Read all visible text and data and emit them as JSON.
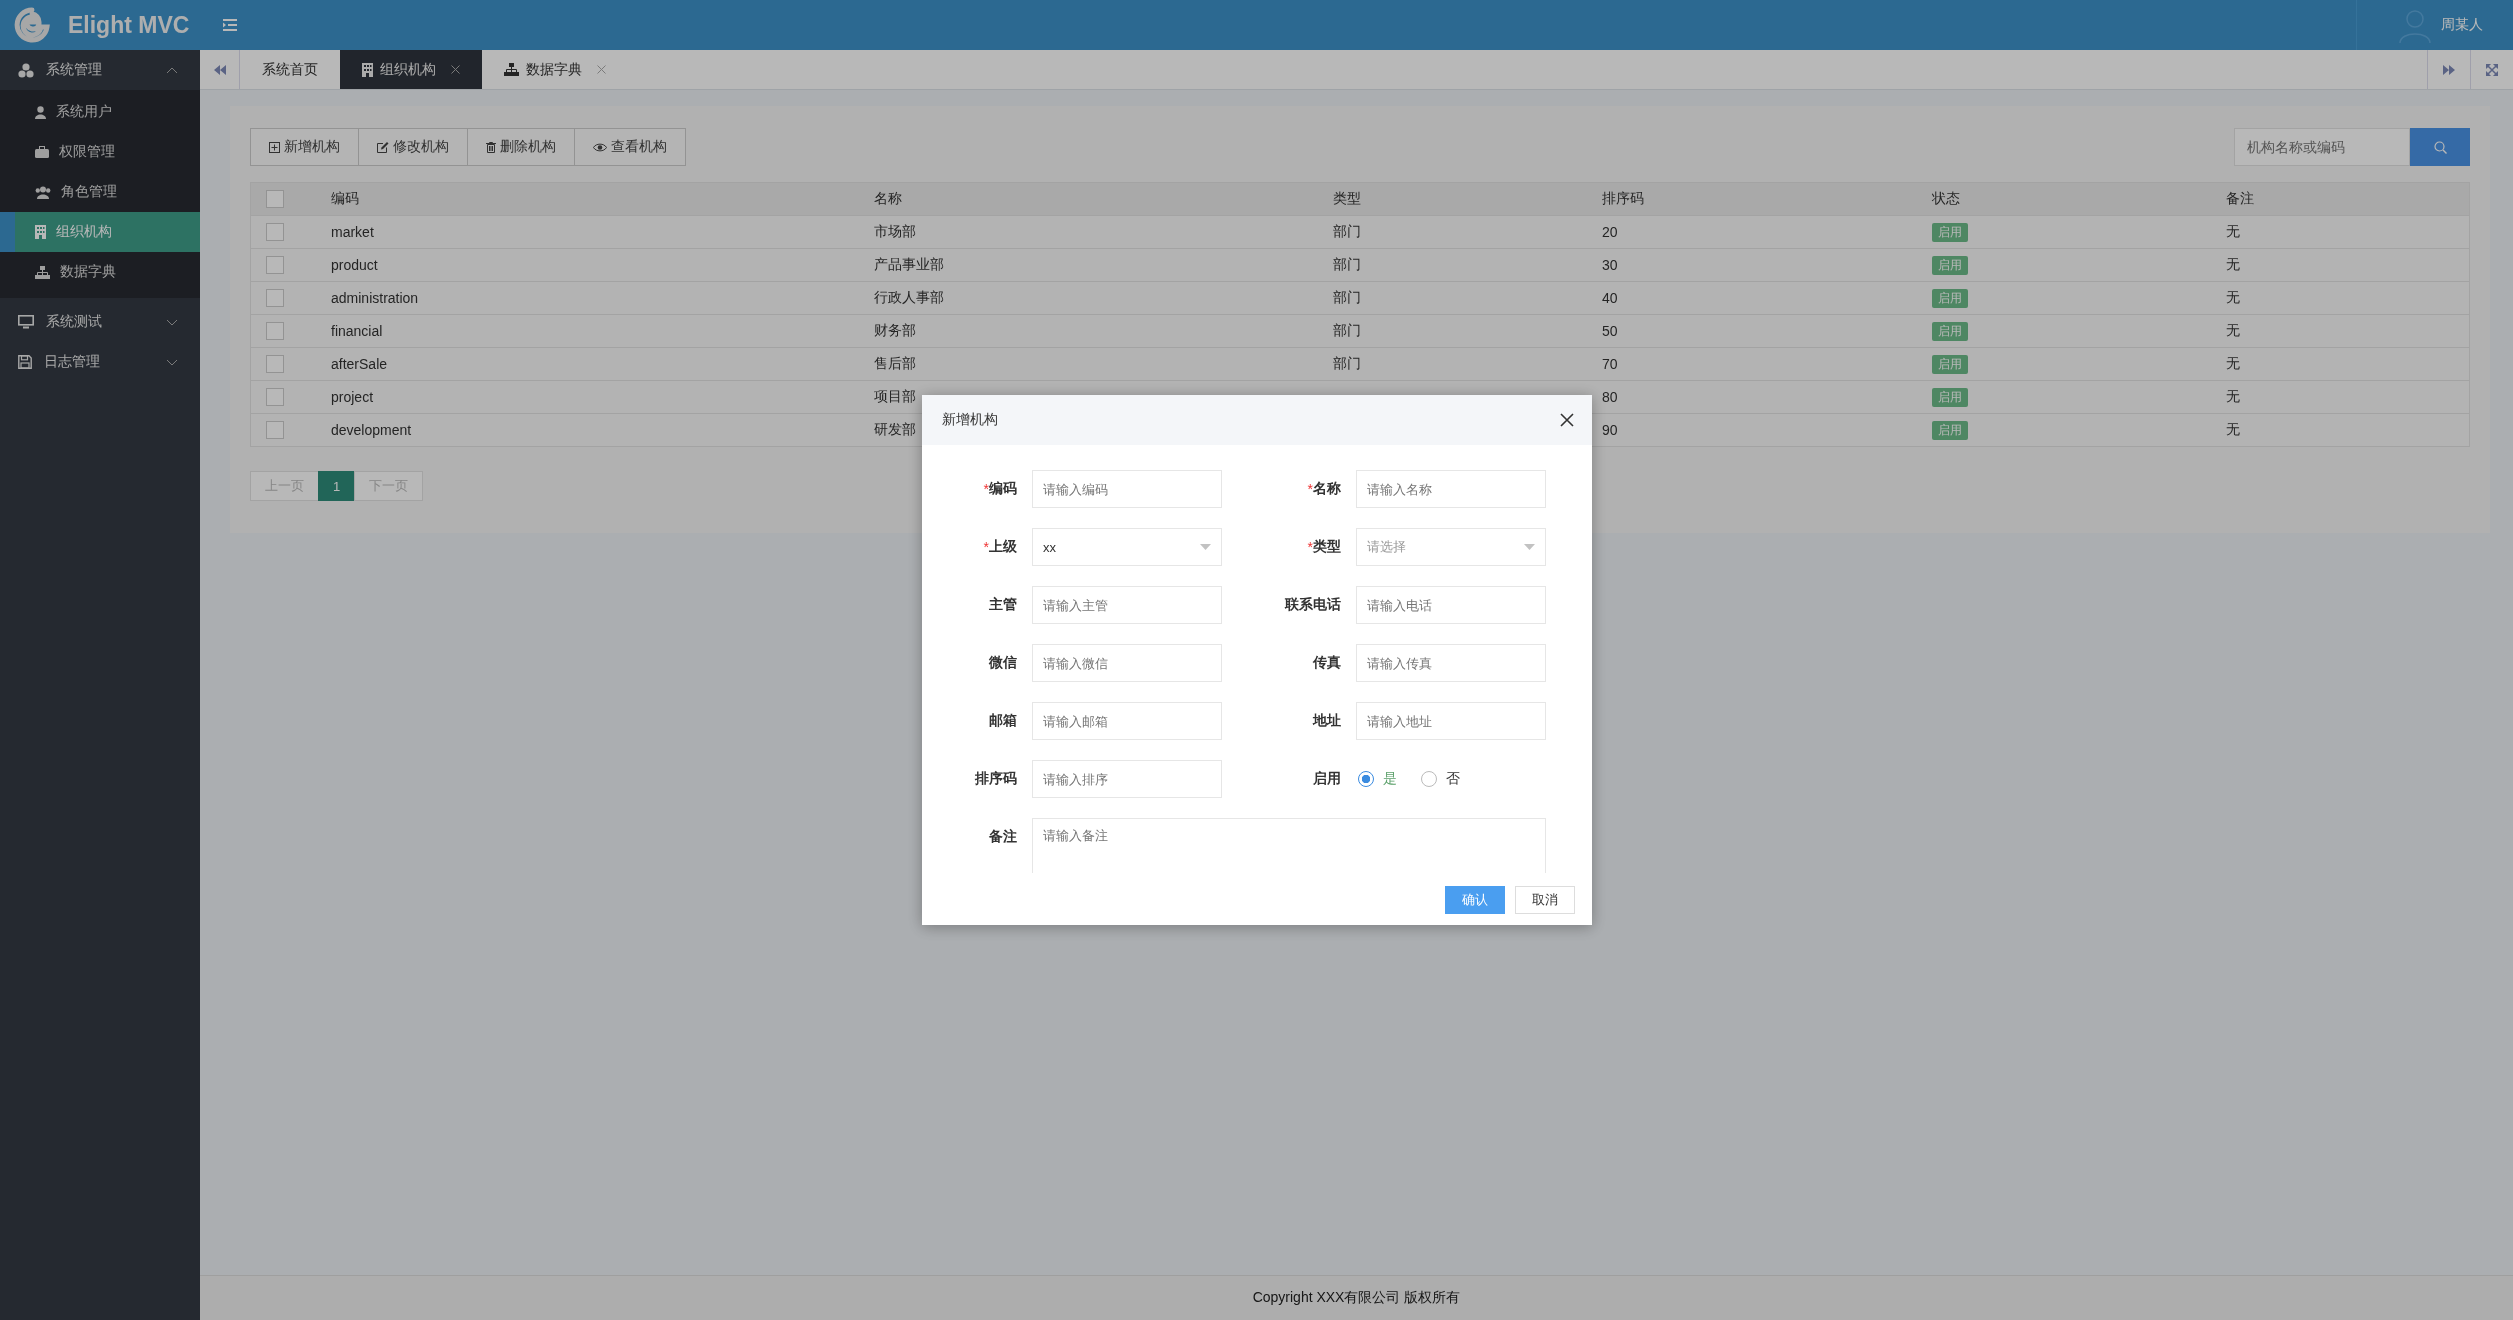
{
  "app": {
    "title": "Elight MVC"
  },
  "user": {
    "name": "周某人"
  },
  "sidebar": {
    "items": [
      {
        "label": "系统管理",
        "expanded": true,
        "children": [
          {
            "label": "系统用户",
            "selected": false
          },
          {
            "label": "权限管理",
            "selected": false
          },
          {
            "label": "角色管理",
            "selected": false
          },
          {
            "label": "组织机构",
            "selected": true
          },
          {
            "label": "数据字典",
            "selected": false
          }
        ]
      },
      {
        "label": "系统测试",
        "expanded": false
      },
      {
        "label": "日志管理",
        "expanded": false
      }
    ]
  },
  "tabs": [
    {
      "label": "系统首页",
      "selected": false,
      "closable": false
    },
    {
      "label": "组织机构",
      "selected": true,
      "closable": true
    },
    {
      "label": "数据字典",
      "selected": false,
      "closable": true
    }
  ],
  "toolbar": {
    "buttons": [
      "新增机构",
      "修改机构",
      "删除机构",
      "查看机构"
    ]
  },
  "search": {
    "placeholder": "机构名称或编码"
  },
  "table": {
    "header_checked": false,
    "columns": [
      "编码",
      "名称",
      "类型",
      "排序码",
      "状态",
      "备注"
    ],
    "rows": [
      {
        "checked": false,
        "code": "market",
        "name": "市场部",
        "type": "部门",
        "sort": "20",
        "status": "启用",
        "remark": "无"
      },
      {
        "checked": false,
        "code": "product",
        "name": "产品事业部",
        "type": "部门",
        "sort": "30",
        "status": "启用",
        "remark": "无"
      },
      {
        "checked": false,
        "code": "administration",
        "name": "行政人事部",
        "type": "部门",
        "sort": "40",
        "status": "启用",
        "remark": "无"
      },
      {
        "checked": false,
        "code": "financial",
        "name": "财务部",
        "type": "部门",
        "sort": "50",
        "status": "启用",
        "remark": "无"
      },
      {
        "checked": false,
        "code": "afterSale",
        "name": "售后部",
        "type": "部门",
        "sort": "70",
        "status": "启用",
        "remark": "无"
      },
      {
        "checked": false,
        "code": "project",
        "name": "项目部",
        "sort": "80",
        "status": "启用",
        "remark": "无"
      },
      {
        "checked": false,
        "code": "development",
        "name": "研发部",
        "sort": "90",
        "status": "启用",
        "remark": "无"
      }
    ]
  },
  "pagination": {
    "prev": "上一页",
    "pages": [
      {
        "label": "1",
        "selected": true
      }
    ],
    "next": "下一页"
  },
  "dialog": {
    "title": "新增机构",
    "fields": [
      {
        "kind": "text",
        "marker": "*",
        "label": "编码",
        "placeholder": "请输入编码"
      },
      {
        "kind": "text",
        "marker": "*",
        "label": "名称",
        "placeholder": "请输入名称"
      },
      {
        "kind": "select",
        "marker": "*",
        "label": "上级",
        "value": "xx"
      },
      {
        "kind": "select",
        "marker": "*",
        "label": "类型",
        "placeholder": "请选择"
      },
      {
        "kind": "text",
        "label": "主管",
        "placeholder": "请输入主管"
      },
      {
        "kind": "text",
        "label": "联系电话",
        "placeholder": "请输入电话"
      },
      {
        "kind": "text",
        "label": "微信",
        "placeholder": "请输入微信"
      },
      {
        "kind": "text",
        "label": "传真",
        "placeholder": "请输入传真"
      },
      {
        "kind": "text",
        "label": "邮箱",
        "placeholder": "请输入邮箱"
      },
      {
        "kind": "text",
        "label": "地址",
        "placeholder": "请输入地址"
      },
      {
        "kind": "text",
        "label": "排序码",
        "placeholder": "请输入排序"
      },
      {
        "kind": "radio",
        "label": "启用",
        "options": [
          {
            "label": "是",
            "selected": true
          },
          {
            "label": "否",
            "selected": false
          }
        ]
      },
      {
        "kind": "textarea",
        "label": "备注",
        "placeholder": "请输入备注"
      }
    ],
    "buttons": [
      {
        "label": "确认",
        "kind": "primary"
      },
      {
        "label": "取消",
        "kind": "default"
      }
    ]
  },
  "footer": "Copyright XXX有限公司 版权所有"
}
